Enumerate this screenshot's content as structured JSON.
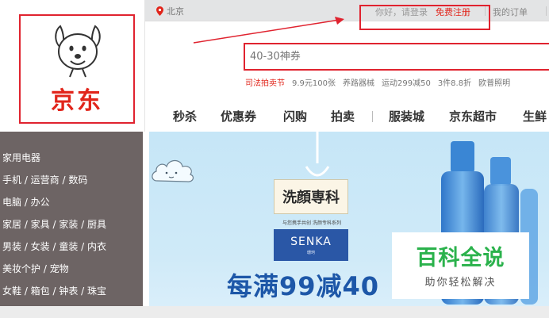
{
  "brand": {
    "logo_text": "京东"
  },
  "topbar": {
    "location": "北京",
    "greeting": "你好，请登录",
    "register": "免费注册",
    "orders": "我的订单"
  },
  "search": {
    "placeholder": "40-30神券"
  },
  "hotwords": [
    {
      "text": "司法拍卖节",
      "highlight": true
    },
    {
      "text": "9.9元100张",
      "highlight": false
    },
    {
      "text": "养路器械",
      "highlight": false
    },
    {
      "text": "运动299减50",
      "highlight": false
    },
    {
      "text": "3件8.8折",
      "highlight": false
    },
    {
      "text": "欧普照明",
      "highlight": false
    }
  ],
  "nav": [
    "秒杀",
    "优惠券",
    "闪购",
    "拍卖",
    "服装城",
    "京东超市",
    "生鲜"
  ],
  "categories": [
    "家用电器",
    "手机 / 运营商 / 数码",
    "电脑 / 办公",
    "家居 / 家具 / 家装 / 厨具",
    "男装 / 女装 / 童装 / 内衣",
    "美妆个护 / 宠物",
    "女鞋 / 箱包 / 钟表 / 珠宝"
  ],
  "banner": {
    "brand_cn": "洗顔専科",
    "brand_sub": "与您携手共创 洗颜专科系列",
    "brand_en": "SENKA",
    "brand_en_sub": "珊珂",
    "promo": "每满99减40"
  },
  "watermark": {
    "main": "百科全说",
    "sub": "助你轻松解决"
  },
  "colors": {
    "jd_red": "#e1251b",
    "annotation_red": "#e0232f",
    "category_bg": "#6d6464",
    "banner_blue": "#1d57a8",
    "watermark_green": "#2bb24c"
  }
}
